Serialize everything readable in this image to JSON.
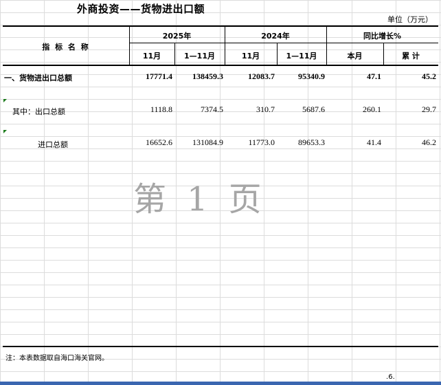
{
  "title": "外商投资——货物进出口额",
  "unit": "单位（万元）",
  "header": {
    "indicator": "指 标 名 称",
    "year2025": "2025年",
    "year2024": "2024年",
    "yoy": "同比增长%",
    "month": "11月",
    "cumulative": "1—11月",
    "this_month": "本月",
    "total": "累 计"
  },
  "rows": [
    {
      "label": "一、货物进出口总额",
      "v2025_m": "17771.4",
      "v2025_c": "138459.3",
      "v2024_m": "12083.7",
      "v2024_c": "95340.9",
      "yoy_m": "47.1",
      "yoy_c": "45.2"
    },
    {
      "label": "其中：出口总额",
      "v2025_m": "1118.8",
      "v2025_c": "7374.5",
      "v2024_m": "310.7",
      "v2024_c": "5687.6",
      "yoy_m": "260.1",
      "yoy_c": "29.7"
    },
    {
      "label": "进口总额",
      "v2025_m": "16652.6",
      "v2025_c": "131084.9",
      "v2024_m": "11773.0",
      "v2024_c": "89653.3",
      "yoy_m": "41.4",
      "yoy_c": "46.2"
    }
  ],
  "watermark": [
    "第",
    "1",
    "页"
  ],
  "note": "注：本表数据取自海口海关官网。",
  "page_number": "6"
}
